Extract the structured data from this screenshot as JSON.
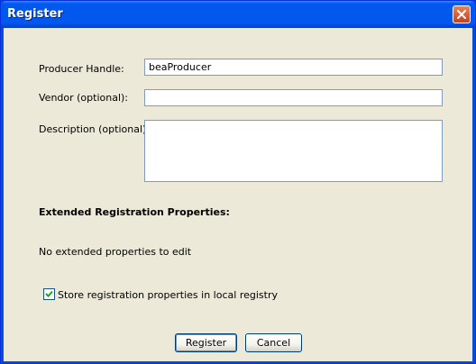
{
  "window": {
    "title": "Register"
  },
  "form": {
    "producer_handle": {
      "label": "Producer Handle:",
      "value": "beaProducer"
    },
    "vendor": {
      "label": "Vendor (optional):",
      "value": ""
    },
    "description": {
      "label": "Description (optional):",
      "value": ""
    }
  },
  "extended": {
    "heading": "Extended Registration Properties:",
    "empty_message": "No extended properties to edit"
  },
  "store_local": {
    "label": "Store registration properties in local registry",
    "checked": true
  },
  "buttons": {
    "register_label": "Register",
    "cancel_label": "Cancel"
  },
  "icons": {
    "close": "close-icon",
    "check": "checkmark-icon"
  },
  "colors": {
    "titlebar": "#0058EE",
    "dialog_background": "#ECE9D8",
    "field_border": "#7F9DB9",
    "close_button": "#C6401E",
    "checkmark": "#21A121"
  }
}
